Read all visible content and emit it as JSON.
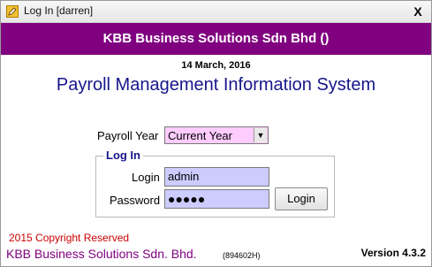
{
  "window": {
    "title": "Log In [darren]",
    "close_glyph": "X",
    "icon": "pencil-note-icon"
  },
  "banner": {
    "company": "KBB Business Solutions Sdn Bhd ()",
    "color": "#800080"
  },
  "date": "14 March, 2016",
  "system_title": "Payroll Management Information System",
  "payroll_year": {
    "label": "Payroll Year",
    "selected": "Current Year",
    "arrow_glyph": "▼"
  },
  "login_group": {
    "title": "Log In",
    "login_label": "Login",
    "login_value": "admin",
    "password_label": "Password",
    "password_mask": "●●●●●",
    "login_button": "Login"
  },
  "footer": {
    "copyright": "2015 Copyright Reserved",
    "company": "KBB Business Solutions Sdn. Bhd.",
    "registration": "(894602H)",
    "version": "Version 4.3.2"
  }
}
